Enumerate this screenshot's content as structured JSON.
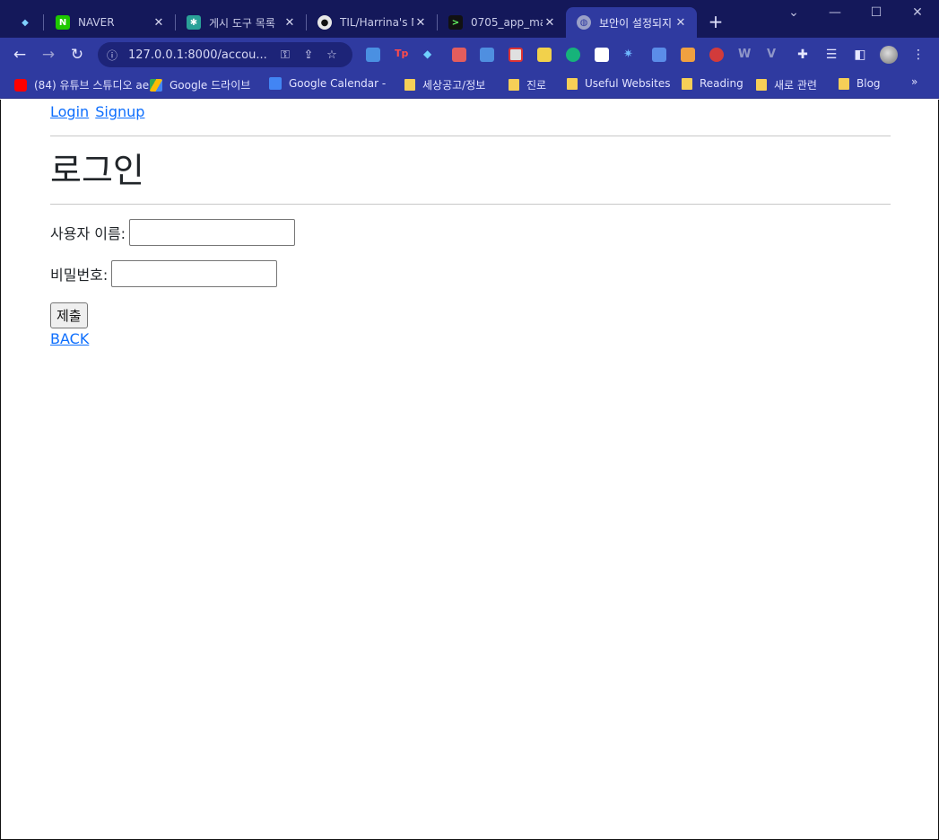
{
  "browser": {
    "tabs": [
      {
        "title": "",
        "icon": "gem-icon"
      },
      {
        "title": "NAVER",
        "icon": "naver-icon"
      },
      {
        "title": "게시 도구 목록",
        "icon": "puzzle-icon"
      },
      {
        "title": "TIL/Harrina's N",
        "icon": "github-icon"
      },
      {
        "title": "0705_app_ma",
        "icon": "terminal-icon"
      },
      {
        "title": "보안이 설정되지",
        "icon": "globe-icon"
      }
    ],
    "new_tab": "+",
    "url": "127.0.0.1:8000/accou...",
    "bookmarks": [
      {
        "label": "(84) 유튜브 스튜디오 ae",
        "icon": "youtube-icon"
      },
      {
        "label": "Google 드라이브",
        "icon": "drive-icon"
      },
      {
        "label": "Google Calendar -",
        "icon": "calendar-icon"
      },
      {
        "label": "세상공고/정보",
        "icon": "folder-icon"
      },
      {
        "label": "진로",
        "icon": "folder-icon"
      },
      {
        "label": "Useful Websites",
        "icon": "folder-icon"
      },
      {
        "label": "Reading",
        "icon": "folder-icon"
      },
      {
        "label": "새로 관련",
        "icon": "folder-icon"
      },
      {
        "label": "Blog",
        "icon": "folder-icon"
      }
    ],
    "bookmarks_more": "»"
  },
  "page": {
    "nav": {
      "login": "Login",
      "signup": "Signup"
    },
    "title": "로그인",
    "username_label": "사용자 이름:",
    "username_value": "",
    "password_label": "비밀번호:",
    "password_value": "",
    "submit_label": "제출",
    "back_label": "BACK"
  },
  "colors": {
    "tabstrip": "#14185a",
    "toolbar": "#2f3aa0",
    "link": "#0d6efd"
  }
}
